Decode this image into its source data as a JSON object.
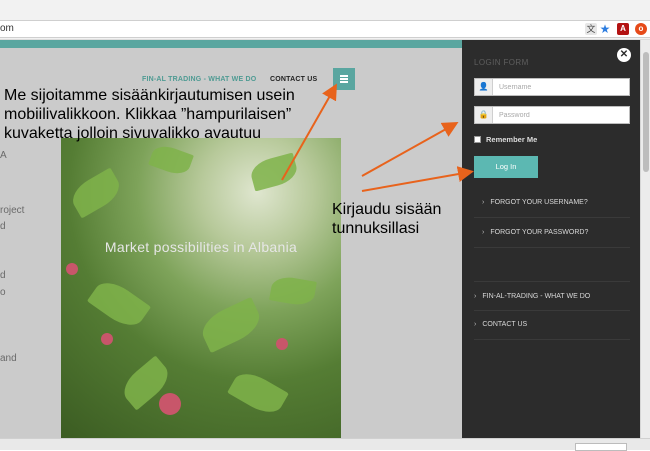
{
  "browser": {
    "url_tail": "om",
    "icons": [
      "translate-icon",
      "bookmark-star-icon",
      "pdf-icon",
      "extension-icon"
    ]
  },
  "site": {
    "nav": [
      {
        "label": "FIN-AL TRADING - WHAT WE DO"
      },
      {
        "label": "CONTACT US"
      }
    ],
    "left_fragments": [
      "A",
      "roject",
      "d",
      "d",
      "o",
      "and"
    ],
    "hero_caption": "Market possibilities in Albania"
  },
  "drawer": {
    "title": "LOGIN FORM",
    "username_placeholder": "Username",
    "password_placeholder": "Password",
    "remember_label": "Remember Me",
    "login_button": "Log In",
    "links": [
      {
        "label": "FORGOT YOUR USERNAME?"
      },
      {
        "label": "FORGOT YOUR PASSWORD?"
      }
    ],
    "menu": [
      {
        "label": "FIN-AL-TRADING - WHAT WE DO"
      },
      {
        "label": "CONTACT US"
      }
    ]
  },
  "annotations": {
    "note_1": "Me sijoitamme sisäänkirjautumisen usein mobiilivalikkoon. Klikkaa ”hampurilaisen” kuvaketta jolloin sivuvalikko avautuu",
    "note_2": "Kirjaudu sisään tunnuksillasi",
    "arrow_color": "#e8631c"
  },
  "colors": {
    "accent": "#5aa6a0",
    "login_button": "#5cb8b2",
    "drawer_bg": "#2c2c2c",
    "page_bg": "#cbcbcb"
  }
}
